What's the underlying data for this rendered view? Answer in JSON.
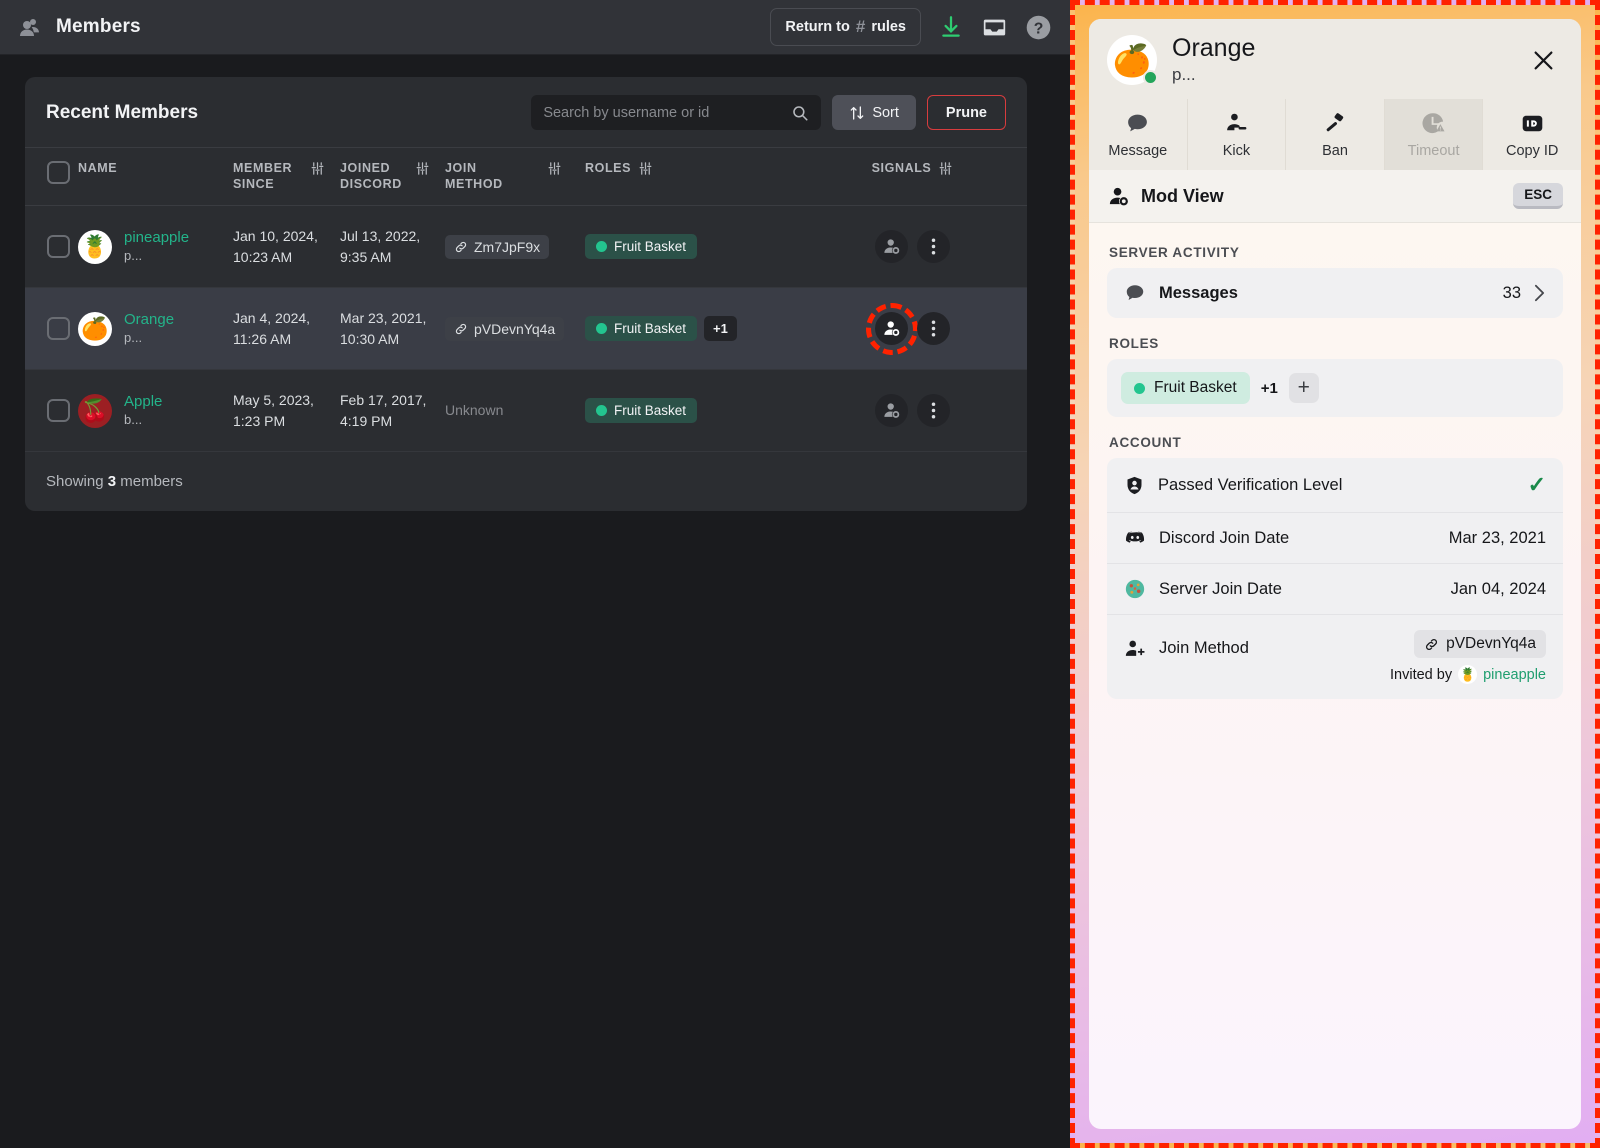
{
  "topbar": {
    "icon": "members-icon",
    "title": "Members",
    "return_label_prefix": "Return to",
    "return_hash": "#",
    "return_channel": "rules",
    "download_icon": "download-icon",
    "inbox_icon": "inbox-icon",
    "help_icon": "help-icon"
  },
  "card": {
    "title": "Recent Members",
    "search_placeholder": "Search by username or id",
    "search_value": "",
    "search_icon": "search-icon",
    "sort_label": "Sort",
    "sort_icon": "sort-arrows-icon",
    "prune_label": "Prune",
    "footer_prefix": "Showing",
    "footer_count": "3",
    "footer_suffix": "members",
    "columns": [
      {
        "label": "NAME",
        "filter": false
      },
      {
        "label": "MEMBER SINCE",
        "filter": true
      },
      {
        "label": "JOINED DISCORD",
        "filter": true
      },
      {
        "label": "JOIN METHOD",
        "filter": true
      },
      {
        "label": "ROLES",
        "filter": true
      },
      {
        "label": "SIGNALS",
        "filter": true
      }
    ],
    "rows": [
      {
        "avatar": "🍍",
        "avatar_kind": "white",
        "username": "pineapple",
        "subtext": "p...",
        "member_since": "Jan 10, 2024, 10:23 AM",
        "joined_discord": "Jul 13, 2022, 9:35 AM",
        "join_method": "Zm7JpF9x",
        "join_method_unknown": false,
        "role": "Fruit Basket",
        "role_extra": "",
        "selected": false,
        "highlighted": false
      },
      {
        "avatar": "🍊",
        "avatar_kind": "white",
        "username": "Orange",
        "subtext": "p...",
        "member_since": "Jan 4, 2024, 11:26 AM",
        "joined_discord": "Mar 23, 2021, 10:30 AM",
        "join_method": "pVDevnYq4a",
        "join_method_unknown": false,
        "role": "Fruit Basket",
        "role_extra": "+1",
        "selected": true,
        "highlighted": true
      },
      {
        "avatar": "🍒",
        "avatar_kind": "berry",
        "username": "Apple",
        "subtext": "b...",
        "member_since": "May 5, 2023, 1:23 PM",
        "joined_discord": "Feb 17, 2017, 4:19 PM",
        "join_method": "Unknown",
        "join_method_unknown": true,
        "role": "Fruit Basket",
        "role_extra": "",
        "selected": false,
        "highlighted": false
      }
    ]
  },
  "panel": {
    "avatar": "🍊",
    "name": "Orange",
    "subtitle": "p...",
    "status": "online",
    "close_icon": "close-icon",
    "actions": [
      {
        "label": "Message",
        "icon": "message-icon",
        "disabled": false
      },
      {
        "label": "Kick",
        "icon": "kick-icon",
        "disabled": false
      },
      {
        "label": "Ban",
        "icon": "hammer-icon",
        "disabled": false
      },
      {
        "label": "Timeout",
        "icon": "timeout-clock-icon",
        "disabled": true
      },
      {
        "label": "Copy ID",
        "icon": "id-icon",
        "disabled": false
      }
    ],
    "mod_view_title": "Mod View",
    "mod_view_icon": "mod-view-icon",
    "esc_label": "ESC",
    "server_activity_label": "SERVER ACTIVITY",
    "messages_label": "Messages",
    "messages_count": "33",
    "roles_label": "ROLES",
    "role_pill": "Fruit Basket",
    "role_extra": "+1",
    "role_add": "+",
    "account_label": "ACCOUNT",
    "verification_label": "Passed Verification Level",
    "verification_check": "✓",
    "discord_join_label": "Discord Join Date",
    "discord_join_value": "Mar 23, 2021",
    "server_join_label": "Server Join Date",
    "server_join_value": "Jan 04, 2024",
    "join_method_label": "Join Method",
    "join_method_code": "pVDevnYq4a",
    "invited_by_prefix": "Invited by",
    "invited_by_avatar": "🍍",
    "invited_by_user": "pineapple"
  },
  "colors": {
    "accent_green": "#23b48a",
    "role_green": "#23c58f",
    "danger_red": "#d83c3e",
    "annotation_red": "#ff2200",
    "download_green": "#2ecc71"
  }
}
